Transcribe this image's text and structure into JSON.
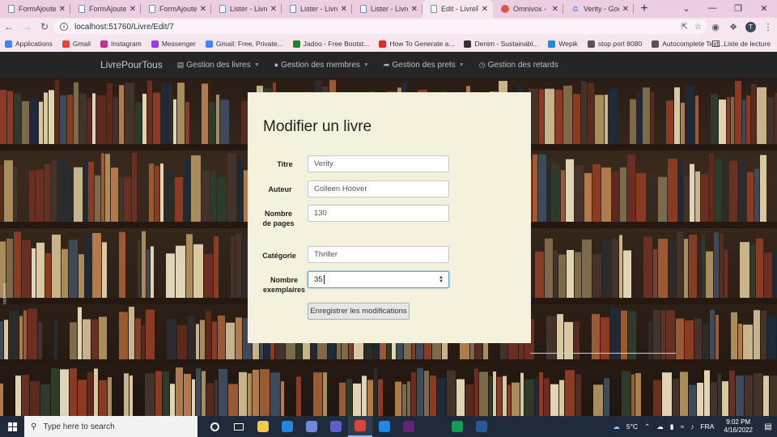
{
  "browser": {
    "tabs": [
      {
        "title": "FormAjouterPr",
        "icon": "page-icon",
        "active": false
      },
      {
        "title": "FormAjouterPr",
        "icon": "page-icon",
        "active": false
      },
      {
        "title": "FormAjouterPr",
        "icon": "page-icon",
        "active": false
      },
      {
        "title": "Lister - LivreP",
        "icon": "page-icon",
        "active": false
      },
      {
        "title": "Lister - LivreP",
        "icon": "page-icon",
        "active": false
      },
      {
        "title": "Lister - LivreP",
        "icon": "page-icon",
        "active": false
      },
      {
        "title": "Edit - LivrePo",
        "icon": "page-icon",
        "active": true
      },
      {
        "title": "Omnivox - Léa",
        "icon": "omnivox-icon",
        "active": false
      },
      {
        "title": "Verity - Googl",
        "icon": "google-icon",
        "active": false
      }
    ],
    "url": "localhost:51760/Livre/Edit/7",
    "profile_initial": "T",
    "bookmarks": [
      {
        "label": "Applications",
        "icon": "apps-grid-icon",
        "color": "#4285f4"
      },
      {
        "label": "Gmail",
        "icon": "gmail-icon",
        "color": "#ea4335"
      },
      {
        "label": "Instagram",
        "icon": "instagram-icon",
        "color": "#c13584"
      },
      {
        "label": "Messenger",
        "icon": "messenger-icon",
        "color": "#a334fa"
      },
      {
        "label": "Gmail: Free, Private...",
        "icon": "google-icon",
        "color": "#4285f4"
      },
      {
        "label": "Jadoo - Free Bootst...",
        "icon": "jadoo-icon",
        "color": "#2e7d32"
      },
      {
        "label": "How To Generate a...",
        "icon": "star-icon",
        "color": "#d32f2f"
      },
      {
        "label": "Denim - Sustainabl...",
        "icon": "denim-icon",
        "color": "#333333"
      },
      {
        "label": "Wepik",
        "icon": "wepik-icon",
        "color": "#1e88e5"
      },
      {
        "label": "stop port 8080",
        "icon": "globe-icon",
        "color": "#555555"
      },
      {
        "label": "Autocomplete Text...",
        "icon": "doc-icon",
        "color": "#555555"
      }
    ],
    "reading_list": "Liste de lecture"
  },
  "site": {
    "brand": "LivrePourTous",
    "nav": [
      {
        "label": "Gestion des livres",
        "icon": "book-icon",
        "dropdown": true
      },
      {
        "label": "Gestion des membres",
        "icon": "user-icon",
        "dropdown": true
      },
      {
        "label": "Gestion des prets",
        "icon": "share-icon",
        "dropdown": true
      },
      {
        "label": "Gestion des retards",
        "icon": "clock-icon",
        "dropdown": false
      }
    ]
  },
  "form": {
    "title": "Modifier un livre",
    "fields": [
      {
        "label": "Titre",
        "value": "Verity"
      },
      {
        "label": "Auteur",
        "value": "Colleen Hoover"
      },
      {
        "label": "Nombre de pages",
        "value": "130"
      },
      {
        "label": "Catégorie",
        "value": "Thriller"
      },
      {
        "label": "Nombre exemplaires",
        "value": "35"
      }
    ],
    "submit_label": "Enregistrer les modifications"
  },
  "watermark": "screenrec",
  "taskbar": {
    "search_placeholder": "Type here to search",
    "apps": [
      {
        "icon": "cortana-icon",
        "color": "#1f2b3a"
      },
      {
        "icon": "task-view-icon",
        "color": "#1f2b3a"
      },
      {
        "icon": "file-explorer-icon",
        "color": "#f2c94c"
      },
      {
        "icon": "edge-icon",
        "color": "#1e88e5"
      },
      {
        "icon": "discord-icon",
        "color": "#7289da"
      },
      {
        "icon": "teams-icon",
        "color": "#5b5fc7"
      },
      {
        "icon": "chrome-icon",
        "color": "#db4437"
      },
      {
        "icon": "app-s-icon",
        "color": "#1e88e5"
      },
      {
        "icon": "visual-studio-icon",
        "color": "#68217a"
      },
      {
        "icon": "shield-icon",
        "color": "#1f2b3a"
      },
      {
        "icon": "photos-icon",
        "color": "#0f9d58"
      },
      {
        "icon": "word-icon",
        "color": "#2b579a"
      },
      {
        "icon": "app-icon",
        "color": "#1f2b3a"
      }
    ],
    "weather": "5°C",
    "language": "FRA",
    "time": "9:02 PM",
    "date": "4/16/2022"
  }
}
